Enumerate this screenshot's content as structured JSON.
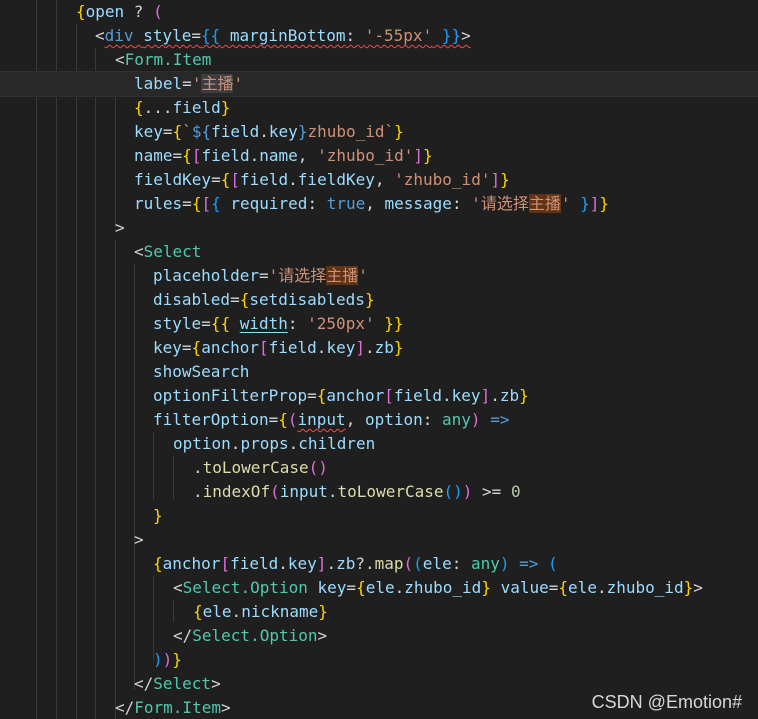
{
  "watermark": "CSDN @Emotion#",
  "lines": [
    [
      {
        "t": "{",
        "c": "t-br-gold"
      },
      {
        "t": "open",
        "c": "t-var"
      },
      {
        "t": " ? ",
        "c": "t-op"
      },
      {
        "t": "(",
        "c": "t-br-pink"
      }
    ],
    [
      {
        "t": "<",
        "c": "t-punct"
      },
      {
        "t": "div",
        "c": "t-tag squiggle"
      },
      {
        "t": " ",
        "c": "t-text squiggle"
      },
      {
        "t": "style",
        "c": "t-attr squiggle"
      },
      {
        "t": "=",
        "c": "t-op squiggle"
      },
      {
        "t": "{{",
        "c": "t-br-blue squiggle"
      },
      {
        "t": " marginBottom",
        "c": "t-prop squiggle"
      },
      {
        "t": ": ",
        "c": "t-op squiggle"
      },
      {
        "t": "'-55px'",
        "c": "t-str squiggle"
      },
      {
        "t": " }}",
        "c": "t-br-blue squiggle"
      },
      {
        "t": ">",
        "c": "t-punct squiggle"
      }
    ],
    [
      {
        "t": "<",
        "c": "t-punct"
      },
      {
        "t": "Form.Item",
        "c": "t-comp"
      }
    ],
    [
      {
        "t": "label",
        "c": "t-attr"
      },
      {
        "t": "=",
        "c": "t-op"
      },
      {
        "t": "'",
        "c": "t-str"
      },
      {
        "t": "主播",
        "c": "t-str hl-select"
      },
      {
        "t": "'",
        "c": "t-str"
      }
    ],
    [
      {
        "t": "{",
        "c": "t-br-gold"
      },
      {
        "t": "...",
        "c": "t-op"
      },
      {
        "t": "field",
        "c": "t-var"
      },
      {
        "t": "}",
        "c": "t-br-gold"
      }
    ],
    [
      {
        "t": "key",
        "c": "t-attr"
      },
      {
        "t": "=",
        "c": "t-op"
      },
      {
        "t": "{",
        "c": "t-br-gold"
      },
      {
        "t": "`",
        "c": "t-str"
      },
      {
        "t": "${",
        "c": "t-kw"
      },
      {
        "t": "field",
        "c": "t-var"
      },
      {
        "t": ".",
        "c": "t-op"
      },
      {
        "t": "key",
        "c": "t-var"
      },
      {
        "t": "}",
        "c": "t-kw"
      },
      {
        "t": "zhubo_id`",
        "c": "t-str"
      },
      {
        "t": "}",
        "c": "t-br-gold"
      }
    ],
    [
      {
        "t": "name",
        "c": "t-attr"
      },
      {
        "t": "=",
        "c": "t-op"
      },
      {
        "t": "{",
        "c": "t-br-gold"
      },
      {
        "t": "[",
        "c": "t-br-pink"
      },
      {
        "t": "field",
        "c": "t-var"
      },
      {
        "t": ".",
        "c": "t-op"
      },
      {
        "t": "name",
        "c": "t-var"
      },
      {
        "t": ", ",
        "c": "t-op"
      },
      {
        "t": "'zhubo_id'",
        "c": "t-str"
      },
      {
        "t": "]",
        "c": "t-br-pink"
      },
      {
        "t": "}",
        "c": "t-br-gold"
      }
    ],
    [
      {
        "t": "fieldKey",
        "c": "t-attr"
      },
      {
        "t": "=",
        "c": "t-op"
      },
      {
        "t": "{",
        "c": "t-br-gold"
      },
      {
        "t": "[",
        "c": "t-br-pink"
      },
      {
        "t": "field",
        "c": "t-var"
      },
      {
        "t": ".",
        "c": "t-op"
      },
      {
        "t": "fieldKey",
        "c": "t-var"
      },
      {
        "t": ", ",
        "c": "t-op"
      },
      {
        "t": "'zhubo_id'",
        "c": "t-str"
      },
      {
        "t": "]",
        "c": "t-br-pink"
      },
      {
        "t": "}",
        "c": "t-br-gold"
      }
    ],
    [
      {
        "t": "rules",
        "c": "t-attr"
      },
      {
        "t": "=",
        "c": "t-op"
      },
      {
        "t": "{",
        "c": "t-br-gold"
      },
      {
        "t": "[",
        "c": "t-br-pink"
      },
      {
        "t": "{",
        "c": "t-br-blue"
      },
      {
        "t": " required",
        "c": "t-prop"
      },
      {
        "t": ": ",
        "c": "t-op"
      },
      {
        "t": "true",
        "c": "t-bool"
      },
      {
        "t": ", ",
        "c": "t-op"
      },
      {
        "t": "message",
        "c": "t-prop"
      },
      {
        "t": ": ",
        "c": "t-op"
      },
      {
        "t": "'请选择",
        "c": "t-str"
      },
      {
        "t": "主播",
        "c": "t-str hl-find"
      },
      {
        "t": "'",
        "c": "t-str"
      },
      {
        "t": " }",
        "c": "t-br-blue"
      },
      {
        "t": "]",
        "c": "t-br-pink"
      },
      {
        "t": "}",
        "c": "t-br-gold"
      }
    ],
    [
      {
        "t": ">",
        "c": "t-punct"
      }
    ],
    [
      {
        "t": "<",
        "c": "t-punct"
      },
      {
        "t": "Select",
        "c": "t-comp"
      }
    ],
    [
      {
        "t": "placeholder",
        "c": "t-attr"
      },
      {
        "t": "=",
        "c": "t-op"
      },
      {
        "t": "'请选择",
        "c": "t-str"
      },
      {
        "t": "主播",
        "c": "t-str hl-find"
      },
      {
        "t": "'",
        "c": "t-str"
      }
    ],
    [
      {
        "t": "disabled",
        "c": "t-attr"
      },
      {
        "t": "=",
        "c": "t-op"
      },
      {
        "t": "{",
        "c": "t-br-gold"
      },
      {
        "t": "setdisableds",
        "c": "t-var"
      },
      {
        "t": "}",
        "c": "t-br-gold"
      }
    ],
    [
      {
        "t": "style",
        "c": "t-attr"
      },
      {
        "t": "=",
        "c": "t-op"
      },
      {
        "t": "{{",
        "c": "t-br-gold"
      },
      {
        "t": " ",
        "c": "t-text"
      },
      {
        "t": "width",
        "c": "t-prop underline"
      },
      {
        "t": ": ",
        "c": "t-op"
      },
      {
        "t": "'250px'",
        "c": "t-str"
      },
      {
        "t": " }}",
        "c": "t-br-gold"
      }
    ],
    [
      {
        "t": "key",
        "c": "t-attr"
      },
      {
        "t": "=",
        "c": "t-op"
      },
      {
        "t": "{",
        "c": "t-br-gold"
      },
      {
        "t": "anchor",
        "c": "t-var"
      },
      {
        "t": "[",
        "c": "t-br-pink"
      },
      {
        "t": "field",
        "c": "t-var"
      },
      {
        "t": ".",
        "c": "t-op"
      },
      {
        "t": "key",
        "c": "t-var"
      },
      {
        "t": "]",
        "c": "t-br-pink"
      },
      {
        "t": ".",
        "c": "t-op"
      },
      {
        "t": "zb",
        "c": "t-var"
      },
      {
        "t": "}",
        "c": "t-br-gold"
      }
    ],
    [
      {
        "t": "showSearch",
        "c": "t-attr"
      }
    ],
    [
      {
        "t": "optionFilterProp",
        "c": "t-attr"
      },
      {
        "t": "=",
        "c": "t-op"
      },
      {
        "t": "{",
        "c": "t-br-gold"
      },
      {
        "t": "anchor",
        "c": "t-var"
      },
      {
        "t": "[",
        "c": "t-br-pink"
      },
      {
        "t": "field",
        "c": "t-var"
      },
      {
        "t": ".",
        "c": "t-op"
      },
      {
        "t": "key",
        "c": "t-var"
      },
      {
        "t": "]",
        "c": "t-br-pink"
      },
      {
        "t": ".",
        "c": "t-op"
      },
      {
        "t": "zb",
        "c": "t-var"
      },
      {
        "t": "}",
        "c": "t-br-gold"
      }
    ],
    [
      {
        "t": "filterOption",
        "c": "t-attr"
      },
      {
        "t": "=",
        "c": "t-op"
      },
      {
        "t": "{",
        "c": "t-br-gold"
      },
      {
        "t": "(",
        "c": "t-br-pink"
      },
      {
        "t": "input",
        "c": "t-var squiggle"
      },
      {
        "t": ", ",
        "c": "t-op"
      },
      {
        "t": "option",
        "c": "t-var"
      },
      {
        "t": ": ",
        "c": "t-op"
      },
      {
        "t": "any",
        "c": "t-type"
      },
      {
        "t": ")",
        "c": "t-br-pink"
      },
      {
        "t": " =>",
        "c": "t-kw"
      }
    ],
    [
      {
        "t": "option",
        "c": "t-var"
      },
      {
        "t": ".",
        "c": "t-op"
      },
      {
        "t": "props",
        "c": "t-var"
      },
      {
        "t": ".",
        "c": "t-op"
      },
      {
        "t": "children",
        "c": "t-var"
      }
    ],
    [
      {
        "t": ".",
        "c": "t-op"
      },
      {
        "t": "toLowerCase",
        "c": "t-fn"
      },
      {
        "t": "()",
        "c": "t-br-pink"
      }
    ],
    [
      {
        "t": ".",
        "c": "t-op"
      },
      {
        "t": "indexOf",
        "c": "t-fn"
      },
      {
        "t": "(",
        "c": "t-br-pink"
      },
      {
        "t": "input",
        "c": "t-var"
      },
      {
        "t": ".",
        "c": "t-op"
      },
      {
        "t": "toLowerCase",
        "c": "t-fn"
      },
      {
        "t": "()",
        "c": "t-br-blue"
      },
      {
        "t": ")",
        "c": "t-br-pink"
      },
      {
        "t": " >= ",
        "c": "t-op"
      },
      {
        "t": "0",
        "c": "t-num"
      }
    ],
    [
      {
        "t": "}",
        "c": "t-br-gold"
      }
    ],
    [
      {
        "t": ">",
        "c": "t-punct"
      }
    ],
    [
      {
        "t": "{",
        "c": "t-br-gold"
      },
      {
        "t": "anchor",
        "c": "t-var"
      },
      {
        "t": "[",
        "c": "t-br-pink"
      },
      {
        "t": "field",
        "c": "t-var"
      },
      {
        "t": ".",
        "c": "t-op"
      },
      {
        "t": "key",
        "c": "t-var"
      },
      {
        "t": "]",
        "c": "t-br-pink"
      },
      {
        "t": ".",
        "c": "t-op"
      },
      {
        "t": "zb",
        "c": "t-var"
      },
      {
        "t": "?.",
        "c": "t-op"
      },
      {
        "t": "map",
        "c": "t-fn"
      },
      {
        "t": "(",
        "c": "t-br-pink"
      },
      {
        "t": "(",
        "c": "t-br-blue"
      },
      {
        "t": "ele",
        "c": "t-var"
      },
      {
        "t": ": ",
        "c": "t-op"
      },
      {
        "t": "any",
        "c": "t-type"
      },
      {
        "t": ")",
        "c": "t-br-blue"
      },
      {
        "t": " => ",
        "c": "t-kw"
      },
      {
        "t": "(",
        "c": "t-br-blue"
      }
    ],
    [
      {
        "t": "<",
        "c": "t-punct"
      },
      {
        "t": "Select.Option",
        "c": "t-comp"
      },
      {
        "t": " ",
        "c": "t-text"
      },
      {
        "t": "key",
        "c": "t-attr"
      },
      {
        "t": "=",
        "c": "t-op"
      },
      {
        "t": "{",
        "c": "t-br-gold"
      },
      {
        "t": "ele",
        "c": "t-var"
      },
      {
        "t": ".",
        "c": "t-op"
      },
      {
        "t": "zhubo_id",
        "c": "t-var"
      },
      {
        "t": "}",
        "c": "t-br-gold"
      },
      {
        "t": " ",
        "c": "t-text"
      },
      {
        "t": "value",
        "c": "t-attr"
      },
      {
        "t": "=",
        "c": "t-op"
      },
      {
        "t": "{",
        "c": "t-br-gold"
      },
      {
        "t": "ele",
        "c": "t-var"
      },
      {
        "t": ".",
        "c": "t-op"
      },
      {
        "t": "zhubo_id",
        "c": "t-var"
      },
      {
        "t": "}",
        "c": "t-br-gold"
      },
      {
        "t": ">",
        "c": "t-punct"
      }
    ],
    [
      {
        "t": "{",
        "c": "t-br-gold"
      },
      {
        "t": "ele",
        "c": "t-var"
      },
      {
        "t": ".",
        "c": "t-op"
      },
      {
        "t": "nickname",
        "c": "t-var"
      },
      {
        "t": "}",
        "c": "t-br-gold"
      }
    ],
    [
      {
        "t": "</",
        "c": "t-punct"
      },
      {
        "t": "Select.Option",
        "c": "t-comp"
      },
      {
        "t": ">",
        "c": "t-punct"
      }
    ],
    [
      {
        "t": ")",
        "c": "t-br-blue"
      },
      {
        "t": ")",
        "c": "t-br-pink"
      },
      {
        "t": "}",
        "c": "t-br-gold"
      }
    ],
    [
      {
        "t": "</",
        "c": "t-punct"
      },
      {
        "t": "Select",
        "c": "t-comp"
      },
      {
        "t": ">",
        "c": "t-punct"
      }
    ],
    [
      {
        "t": "</",
        "c": "t-punct"
      },
      {
        "t": "Form.Item",
        "c": "t-comp"
      },
      {
        "t": ">",
        "c": "t-punct"
      }
    ]
  ]
}
